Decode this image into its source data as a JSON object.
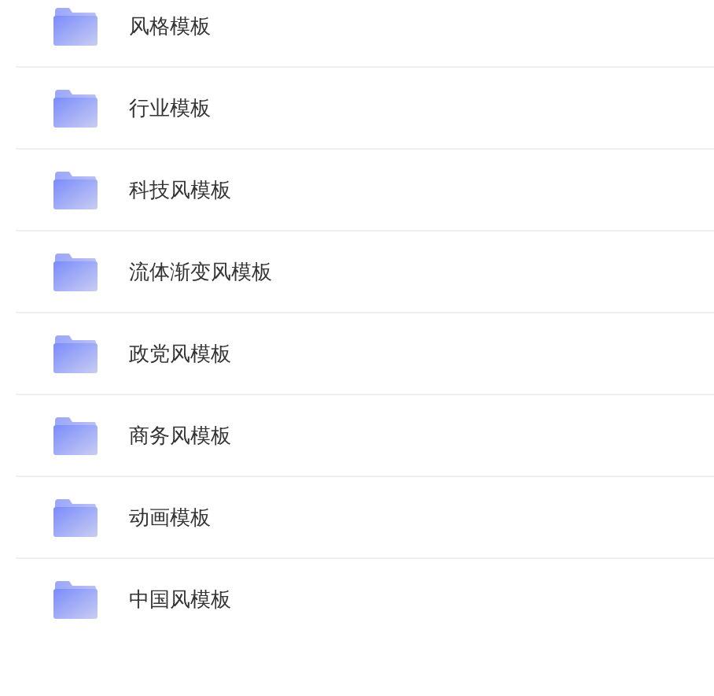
{
  "folders": [
    {
      "name": "风格模板"
    },
    {
      "name": "行业模板"
    },
    {
      "name": "科技风模板"
    },
    {
      "name": "流体渐变风模板"
    },
    {
      "name": "政党风模板"
    },
    {
      "name": "商务风模板"
    },
    {
      "name": "动画模板"
    },
    {
      "name": "中国风模板"
    }
  ]
}
